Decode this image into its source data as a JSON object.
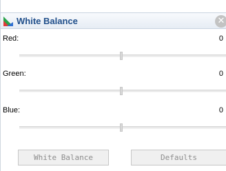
{
  "window": {
    "title": "White Balance",
    "title_icon": "color-triangle-icon",
    "close_icon": "close-icon"
  },
  "channels": [
    {
      "label": "Red:",
      "value": "0",
      "level": 0
    },
    {
      "label": "Green:",
      "value": "0",
      "level": 0
    },
    {
      "label": "Blue:",
      "value": "0",
      "level": 0
    }
  ],
  "buttons": {
    "white_balance": "White Balance",
    "defaults": "Defaults"
  },
  "colors": {
    "title_text": "#1f4e8a",
    "button_text": "#8d8d8d"
  }
}
